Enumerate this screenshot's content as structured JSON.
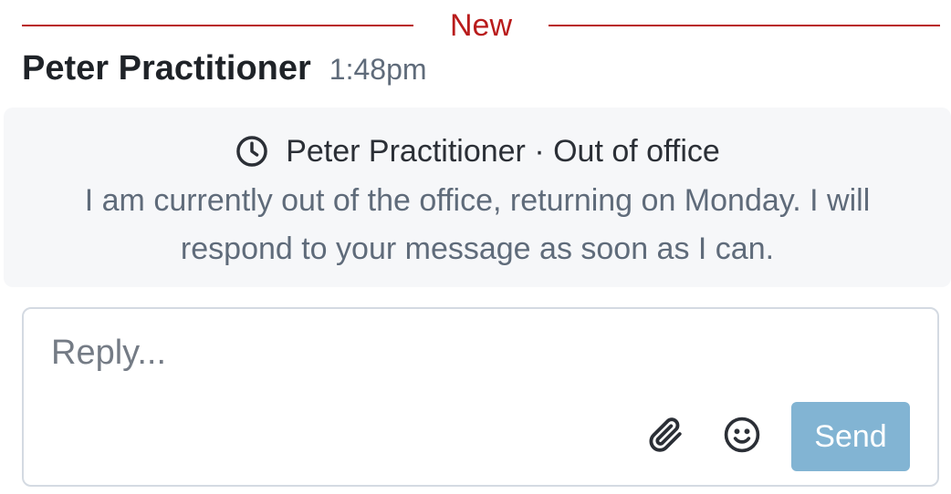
{
  "divider": {
    "label": "New"
  },
  "message": {
    "sender": "Peter Practitioner",
    "time": "1:48pm"
  },
  "out_of_office": {
    "icon": "clock-icon",
    "title": "Peter Practitioner · Out of office",
    "body": "I am currently out of the office, returning on Monday. I will respond to your message as soon as I can."
  },
  "reply": {
    "placeholder": "Reply...",
    "value": "",
    "attach_icon": "paperclip-icon",
    "emoji_icon": "smiley-icon",
    "send_label": "Send"
  },
  "colors": {
    "accent_new": "#b91c1c",
    "send_button": "#82b4d3",
    "card_background": "#f6f7f9"
  }
}
